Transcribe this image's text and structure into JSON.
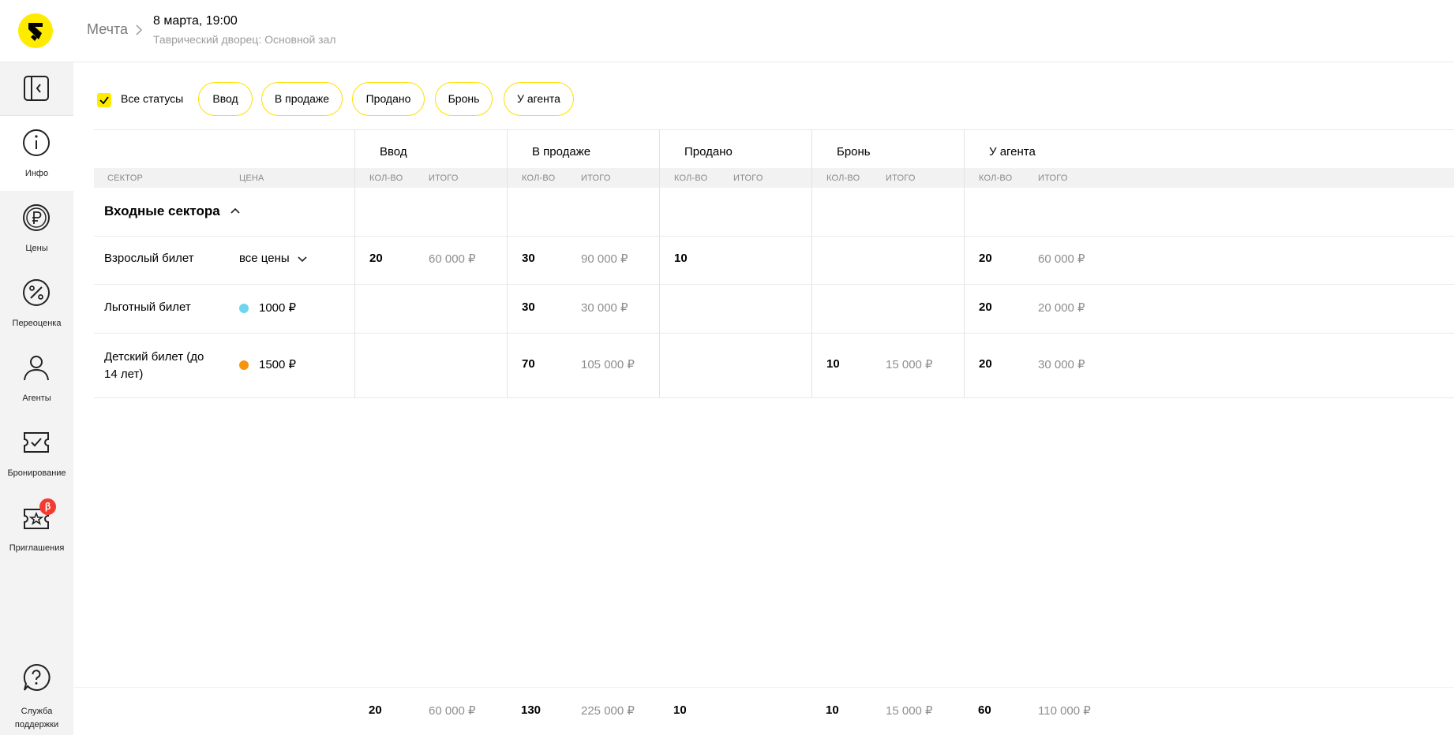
{
  "header": {
    "event_name": "Мечта",
    "event_date": "8 марта, 19:00",
    "venue": "Таврический дворец: Основной зал"
  },
  "sidebar": {
    "items": [
      {
        "label": "Инфо",
        "icon": "info-icon"
      },
      {
        "label": "Цены",
        "icon": "ruble-icon"
      },
      {
        "label": "Переоценка",
        "icon": "percent-icon"
      },
      {
        "label": "Агенты",
        "icon": "person-icon"
      },
      {
        "label": "Бронирование",
        "icon": "ticket-check-icon"
      },
      {
        "label": "Приглашения",
        "icon": "ticket-star-icon",
        "badge": "β"
      }
    ],
    "support_line1": "Служба",
    "support_line2": "поддержки"
  },
  "filters": {
    "all_label": "Все статусы",
    "chips": [
      "Ввод",
      "В продаже",
      "Продано",
      "Бронь",
      "У агента"
    ]
  },
  "table": {
    "groups": [
      "Ввод",
      "В продаже",
      "Продано",
      "Бронь",
      "У агента"
    ],
    "sector_header": "Сектор",
    "price_header": "Цена",
    "qty_header": "Кол-во",
    "total_header": "Итого",
    "section_title": "Входные сектора",
    "rows": [
      {
        "name": "Взрослый билет",
        "price": "все цены",
        "cells": [
          {
            "qty": "20",
            "total": "60 000 ₽"
          },
          {
            "qty": "30",
            "total": "90 000 ₽"
          },
          {
            "qty": "10",
            "total": ""
          },
          {
            "qty": "",
            "total": ""
          },
          {
            "qty": "20",
            "total": "60 000 ₽"
          }
        ]
      },
      {
        "name": "Льготный билет",
        "price": "1000 ₽",
        "dot_color": "#6fd4ee",
        "cells": [
          {
            "qty": "",
            "total": ""
          },
          {
            "qty": "30",
            "total": "30 000 ₽"
          },
          {
            "qty": "",
            "total": ""
          },
          {
            "qty": "",
            "total": ""
          },
          {
            "qty": "20",
            "total": "20 000 ₽"
          }
        ]
      },
      {
        "name_line1": "Детский билет (до",
        "name_line2": "14 лет)",
        "price": "1500 ₽",
        "dot_color": "#f7940e",
        "cells": [
          {
            "qty": "",
            "total": ""
          },
          {
            "qty": "70",
            "total": "105 000 ₽"
          },
          {
            "qty": "",
            "total": ""
          },
          {
            "qty": "10",
            "total": "15 000 ₽"
          },
          {
            "qty": "20",
            "total": "30 000 ₽"
          }
        ]
      }
    ],
    "totals": [
      {
        "qty": "20",
        "total": "60 000 ₽"
      },
      {
        "qty": "130",
        "total": "225 000 ₽"
      },
      {
        "qty": "10",
        "total": ""
      },
      {
        "qty": "10",
        "total": "15 000 ₽"
      },
      {
        "qty": "60",
        "total": "110 000 ₽"
      }
    ]
  },
  "colors": {
    "accent": "#ffeb00",
    "chip_border": "#ffdf00",
    "badge": "#f33b2f"
  }
}
